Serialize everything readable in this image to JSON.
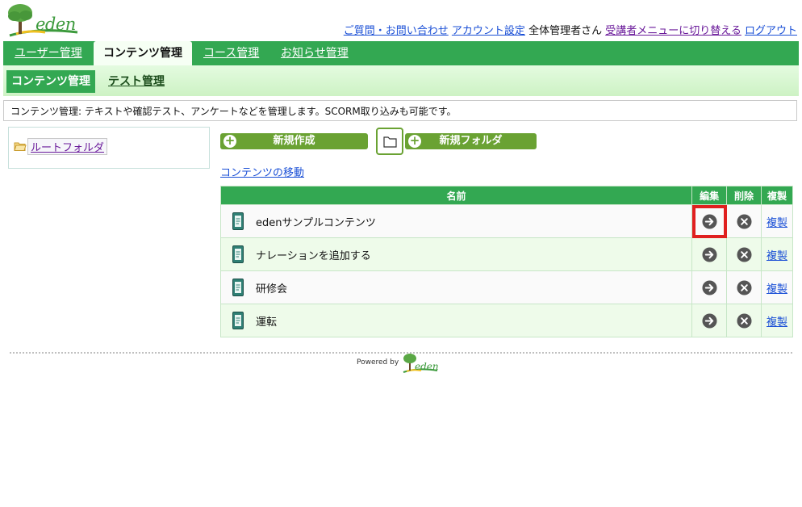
{
  "header": {
    "logo_text": "eden",
    "links": {
      "faq": "ご質問・お問い合わせ",
      "account": "アカウント設定",
      "user": "全体管理者さん",
      "switch": "受講者メニューに切り替える",
      "logout": "ログアウト"
    }
  },
  "nav": {
    "tabs": [
      "ユーザー管理",
      "コンテンツ管理",
      "コース管理",
      "お知らせ管理"
    ],
    "active": "コンテンツ管理"
  },
  "subnav": {
    "tabs": [
      "コンテンツ管理",
      "テスト管理"
    ],
    "active": "コンテンツ管理"
  },
  "description": "コンテンツ管理: テキストや確認テスト、アンケートなどを管理します。SCORM取り込みも可能です。",
  "folder_tree": {
    "root_label": "ルートフォルダ"
  },
  "toolbar": {
    "new_button": "新規作成",
    "new_folder_button": "新規フォルダ",
    "move_link": "コンテンツの移動"
  },
  "table": {
    "headers": {
      "name": "名前",
      "edit": "編集",
      "delete": "削除",
      "copy": "複製"
    },
    "rows": [
      {
        "name": "edenサンプルコンテンツ",
        "copy": "複製"
      },
      {
        "name": "ナレーションを追加する",
        "copy": "複製"
      },
      {
        "name": "研修会",
        "copy": "複製"
      },
      {
        "name": "運転",
        "copy": "複製"
      }
    ],
    "highlighted_edit_row": 0
  },
  "footer": {
    "powered_by": "Powered by",
    "logo_text": "eden"
  },
  "colors": {
    "nav_green": "#33a852",
    "button_green": "#6aa233",
    "highlight_red": "#e0201f"
  }
}
